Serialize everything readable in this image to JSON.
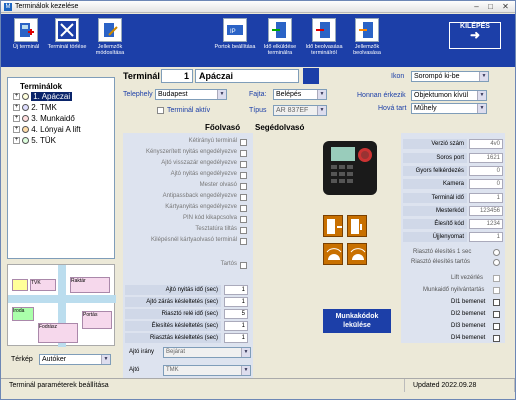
{
  "window": {
    "title": "Terminálok kezelése"
  },
  "toolbar": {
    "buttons": [
      {
        "label": "Új terminál",
        "icon": "new-terminal-icon"
      },
      {
        "label": "Terminál törlése",
        "icon": "delete-terminal-icon"
      },
      {
        "label": "Jellemzők módosítása",
        "icon": "edit-properties-icon"
      },
      {
        "label": "Portok beállítása",
        "icon": "ports-icon"
      },
      {
        "label": "Idő elküldése terminálra",
        "icon": "send-time-icon"
      },
      {
        "label": "Idő beolvasása terminálról",
        "icon": "read-time-icon"
      },
      {
        "label": "Jellemzők beolvasása",
        "icon": "read-properties-icon"
      }
    ],
    "exit_label": "KILÉPÉS"
  },
  "tree": {
    "root": "Terminálok",
    "items": [
      {
        "label": "1. Apáczai",
        "selected": true
      },
      {
        "label": "2. TMK"
      },
      {
        "label": "3. Munkaidő"
      },
      {
        "label": "4. Lónyai A lift"
      },
      {
        "label": "5. TÜK"
      }
    ]
  },
  "map_labels": [
    "TVK",
    "Raktár",
    "Iroda",
    "Fodrász",
    "Portás"
  ],
  "terrain": {
    "label": "Térkép",
    "value": "Autóker"
  },
  "header": {
    "terminal_label": "Terminál",
    "terminal_no": "1",
    "terminal_name": "Apáczai",
    "location_label": "Telephely",
    "location_value": "Budapest",
    "type_label": "Fajta:",
    "type_value": "Belépés",
    "active_label": "Terminál aktív",
    "model_label": "Típus",
    "model_value": "AR 837EF",
    "icon_label": "Ikon",
    "icon_value": "Sorompó ki-be",
    "where_label": "Honnan érkezik",
    "where_value": "Objektumon kívül",
    "dest_label": "Hová tart",
    "dest_value": "Műhely"
  },
  "left_panel": {
    "col_master": "Főolvasó",
    "col_slave": "Segédolvasó",
    "checks": [
      "Kétirányú terminál",
      "Kényszerített nyitás engedélyezve",
      "Ajtó visszazár engedélyezve",
      "Ajtó nyitás engedélyezve",
      "Mester olvasó",
      "Antipassback engedélyezve",
      "Kártyanyitás engedélyezve",
      "PIN kód kikapcsolva",
      "Tesztatúra tiltás",
      "Kilépésnél kártyaolvasó terminál",
      "Tartós"
    ],
    "numbers": [
      {
        "label": "Ajtó nyitás idő (sec)",
        "value": "1"
      },
      {
        "label": "Ajtó zárás késleltetés (sec)",
        "value": "1"
      },
      {
        "label": "Riasztó relé idő (sec)",
        "value": "5"
      },
      {
        "label": "Élesítés késleltetés (sec)",
        "value": "1"
      },
      {
        "label": "Riasztás késleltetés (sec)",
        "value": "1"
      }
    ],
    "door_dir_label": "Ajtó irány",
    "door_dir_value": "Bejárat",
    "door_label": "Ajtó",
    "door_value": "TMK"
  },
  "right_panel": {
    "rows": [
      {
        "label": "Verzió szám",
        "value": "4v0"
      },
      {
        "label": "Soros port",
        "value": "1621"
      },
      {
        "label": "Gyors felkérdezés",
        "value": "0"
      },
      {
        "label": "Kamera",
        "value": "0"
      },
      {
        "label": "Terminál idő",
        "value": "1"
      },
      {
        "label": "Mesterkód",
        "value": "123456"
      },
      {
        "label": "Élesítő kód",
        "value": "1234"
      },
      {
        "label": "Újjlenyomat",
        "value": "1"
      }
    ],
    "radio1": "Riasztó élesítés 1 sec",
    "radio2": "Riasztó élesítés tartós",
    "check_labels": [
      "Lift vezérlés",
      "Munkaidő nyilvántartás",
      "DI1 bemenet",
      "DI2 bemenet",
      "DI3 bemenet",
      "DI4 bemenet"
    ]
  },
  "workcode_button": "Munkakódok lekülése",
  "status": {
    "left": "Terminál paraméterek beállítása",
    "right": "Updated 2022.09.28"
  }
}
